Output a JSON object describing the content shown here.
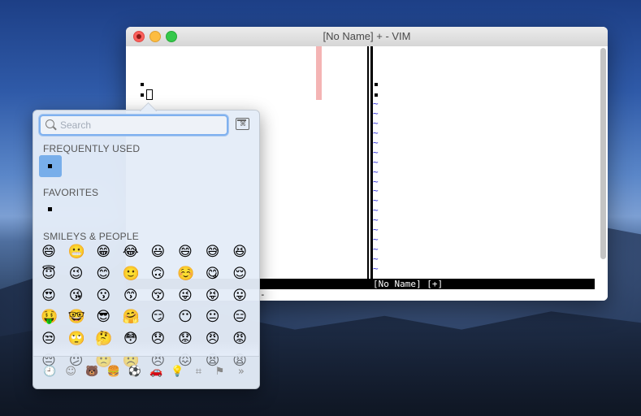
{
  "vim": {
    "title": "[No Name] + - VIM",
    "status_text": "[No Name] [+]",
    "command_line": "-",
    "tilde_char": "~"
  },
  "picker": {
    "search_placeholder": "Search",
    "sections": {
      "frequently_used": "FREQUENTLY USED",
      "favorites": "FAVORITES",
      "smileys_people": "SMILEYS & PEOPLE"
    },
    "emojis": [
      "😄",
      "😬",
      "😁",
      "😂",
      "😃",
      "😄",
      "😅",
      "😆",
      "😇",
      "😉",
      "😊",
      "🙂",
      "🙃",
      "☺️",
      "😋",
      "😌",
      "😍",
      "😘",
      "😗",
      "😙",
      "😚",
      "😜",
      "😝",
      "😛",
      "🤑",
      "🤓",
      "😎",
      "🤗",
      "😏",
      "😶",
      "😐",
      "😑",
      "😒",
      "🙄",
      "🤔",
      "😳",
      "😞",
      "😟",
      "😠",
      "😡",
      "😔",
      "😕",
      "🙁",
      "☹️",
      "😣",
      "😖",
      "😫",
      "😩"
    ],
    "categories": [
      {
        "icon": "clock-icon",
        "glyph": "🕘"
      },
      {
        "icon": "smiley-icon",
        "glyph": "☺"
      },
      {
        "icon": "animal-icon",
        "glyph": "🐻"
      },
      {
        "icon": "food-icon",
        "glyph": "🍔"
      },
      {
        "icon": "sports-icon",
        "glyph": "⚽"
      },
      {
        "icon": "travel-icon",
        "glyph": "🚗"
      },
      {
        "icon": "bulb-icon",
        "glyph": "💡"
      },
      {
        "icon": "symbols-icon",
        "glyph": "⌗"
      },
      {
        "icon": "flag-icon",
        "glyph": "⚑"
      },
      {
        "icon": "more-icon",
        "glyph": "»"
      }
    ]
  }
}
